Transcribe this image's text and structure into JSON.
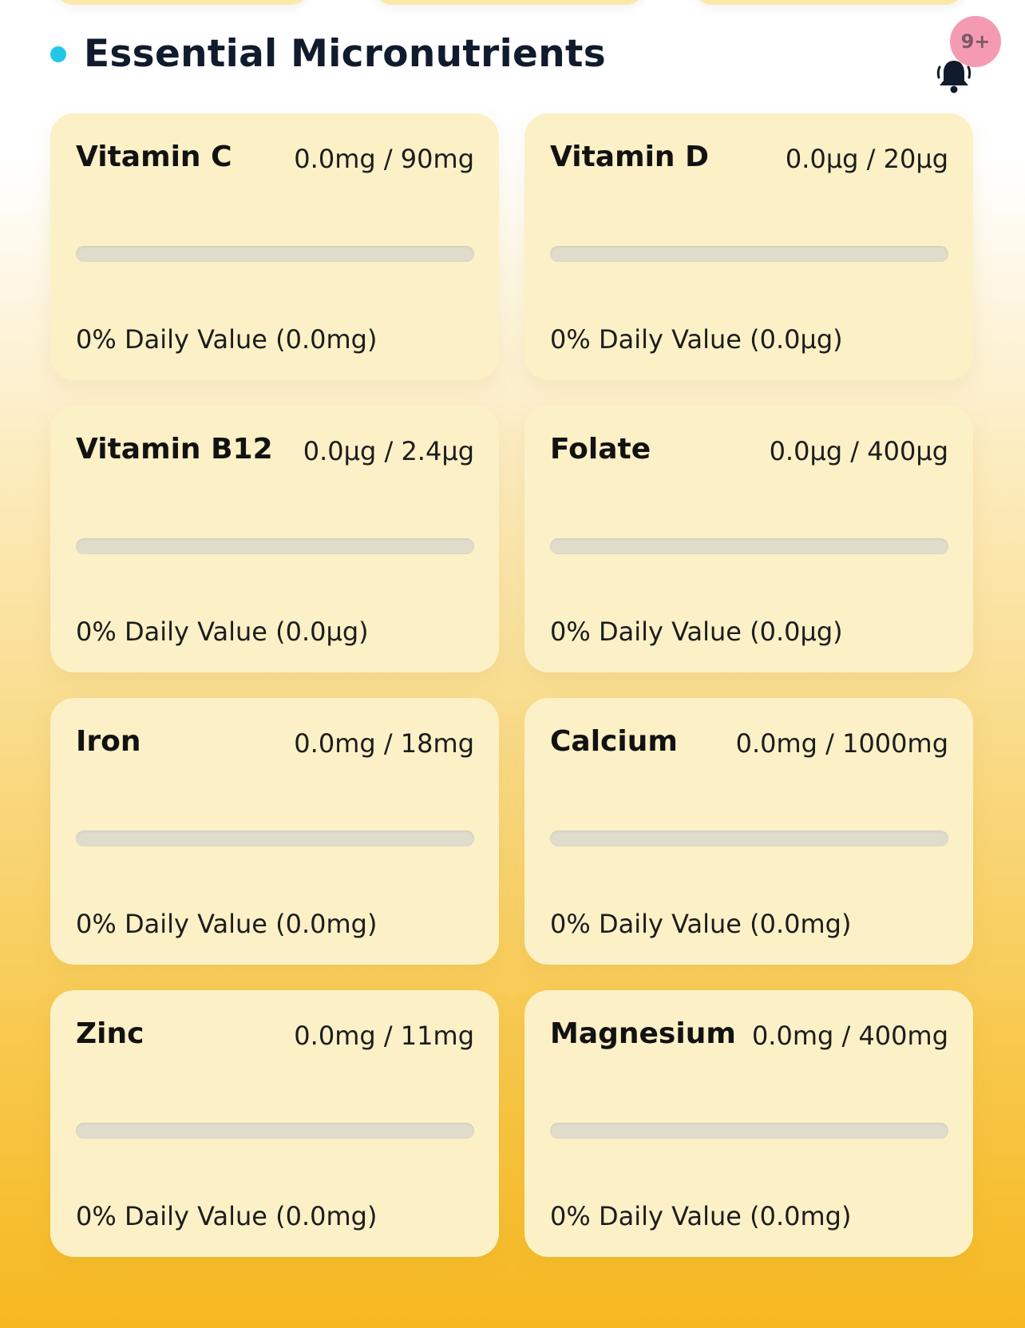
{
  "header": {
    "title": "Essential Micronutrients",
    "notification_badge": "9+"
  },
  "colors": {
    "accent_dot": "#22c7e8",
    "badge": "#f49bb2",
    "card": "#fcf0c6",
    "progress_track": "#e0dccb",
    "progress_fill": "#f6b820"
  },
  "nutrients": [
    {
      "name": "Vitamin C",
      "amount": "0.0mg / 90mg",
      "daily_value": "0% Daily Value (0.0mg)",
      "progress": 0
    },
    {
      "name": "Vitamin D",
      "amount": "0.0µg / 20µg",
      "daily_value": "0% Daily Value (0.0µg)",
      "progress": 0
    },
    {
      "name": "Vitamin B12",
      "amount": "0.0µg / 2.4µg",
      "daily_value": "0% Daily Value (0.0µg)",
      "progress": 0
    },
    {
      "name": "Folate",
      "amount": "0.0µg / 400µg",
      "daily_value": "0% Daily Value (0.0µg)",
      "progress": 0
    },
    {
      "name": "Iron",
      "amount": "0.0mg / 18mg",
      "daily_value": "0% Daily Value (0.0mg)",
      "progress": 0
    },
    {
      "name": "Calcium",
      "amount": "0.0mg / 1000mg",
      "daily_value": "0% Daily Value (0.0mg)",
      "progress": 0
    },
    {
      "name": "Zinc",
      "amount": "0.0mg / 11mg",
      "daily_value": "0% Daily Value (0.0mg)",
      "progress": 0
    },
    {
      "name": "Magnesium",
      "amount": "0.0mg / 400mg",
      "daily_value": "0% Daily Value (0.0mg)",
      "progress": 0
    }
  ]
}
